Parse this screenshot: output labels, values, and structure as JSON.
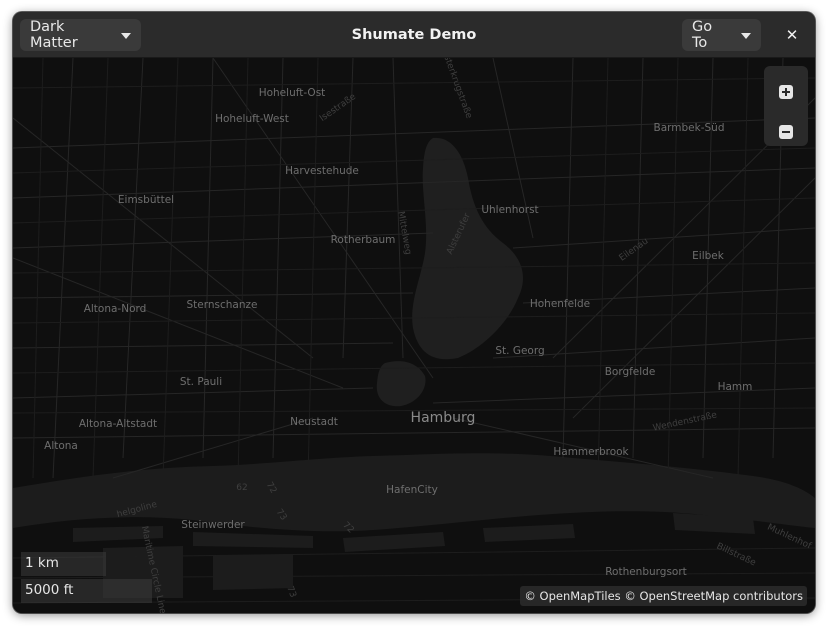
{
  "header": {
    "style_menu_label": "Dark Matter",
    "title": "Shumate Demo",
    "goto_label": "Go To",
    "close_glyph": "✕"
  },
  "map": {
    "theme_colors": {
      "background": "#0f0f0f",
      "roads": "#2a2a2a",
      "water": "#1f1f1f",
      "labels": "#6e6e6e"
    },
    "zoom": {
      "in_glyph": "+",
      "out_glyph": "−"
    },
    "scale": {
      "metric": "1 km",
      "imperial": "5000 ft"
    },
    "attribution": "© OpenMapTiles © OpenStreetMap contributors",
    "places": [
      {
        "name": "Hoheluft-Ost",
        "big": false
      },
      {
        "name": "Hoheluft-West",
        "big": false
      },
      {
        "name": "Harvestehude",
        "big": false
      },
      {
        "name": "Eimsbüttel",
        "big": false
      },
      {
        "name": "Rotherbaum",
        "big": false
      },
      {
        "name": "Uhlenhorst",
        "big": false
      },
      {
        "name": "Barmbek-Süd",
        "big": false
      },
      {
        "name": "Eilbek",
        "big": false
      },
      {
        "name": "Hohenfelde",
        "big": false
      },
      {
        "name": "Altona-Nord",
        "big": false
      },
      {
        "name": "Sternschanze",
        "big": false
      },
      {
        "name": "St. Georg",
        "big": false
      },
      {
        "name": "St. Pauli",
        "big": false
      },
      {
        "name": "Borgfelde",
        "big": false
      },
      {
        "name": "Hamm",
        "big": false
      },
      {
        "name": "Altona-Altstadt",
        "big": false
      },
      {
        "name": "Neustadt",
        "big": false
      },
      {
        "name": "Hamburg",
        "big": true
      },
      {
        "name": "Altona",
        "big": false
      },
      {
        "name": "Hammerbrook",
        "big": false
      },
      {
        "name": "HafenCity",
        "big": false
      },
      {
        "name": "Steinwerder",
        "big": false
      },
      {
        "name": "Rothenburgsort",
        "big": false
      }
    ],
    "streets": [
      {
        "name": "Isestraße"
      },
      {
        "name": "Alsterkrugstraße"
      },
      {
        "name": "Mittelweg"
      },
      {
        "name": "Alsterufer"
      },
      {
        "name": "Eilenau"
      },
      {
        "name": "Wendenstraße"
      },
      {
        "name": "Billstraße"
      },
      {
        "name": "Muhlenhof"
      },
      {
        "name": "helgoline"
      },
      {
        "name": "Maritime Circle Line"
      },
      {
        "name": "62"
      },
      {
        "name": "72"
      },
      {
        "name": "73"
      },
      {
        "name": "72"
      },
      {
        "name": "73"
      }
    ]
  }
}
